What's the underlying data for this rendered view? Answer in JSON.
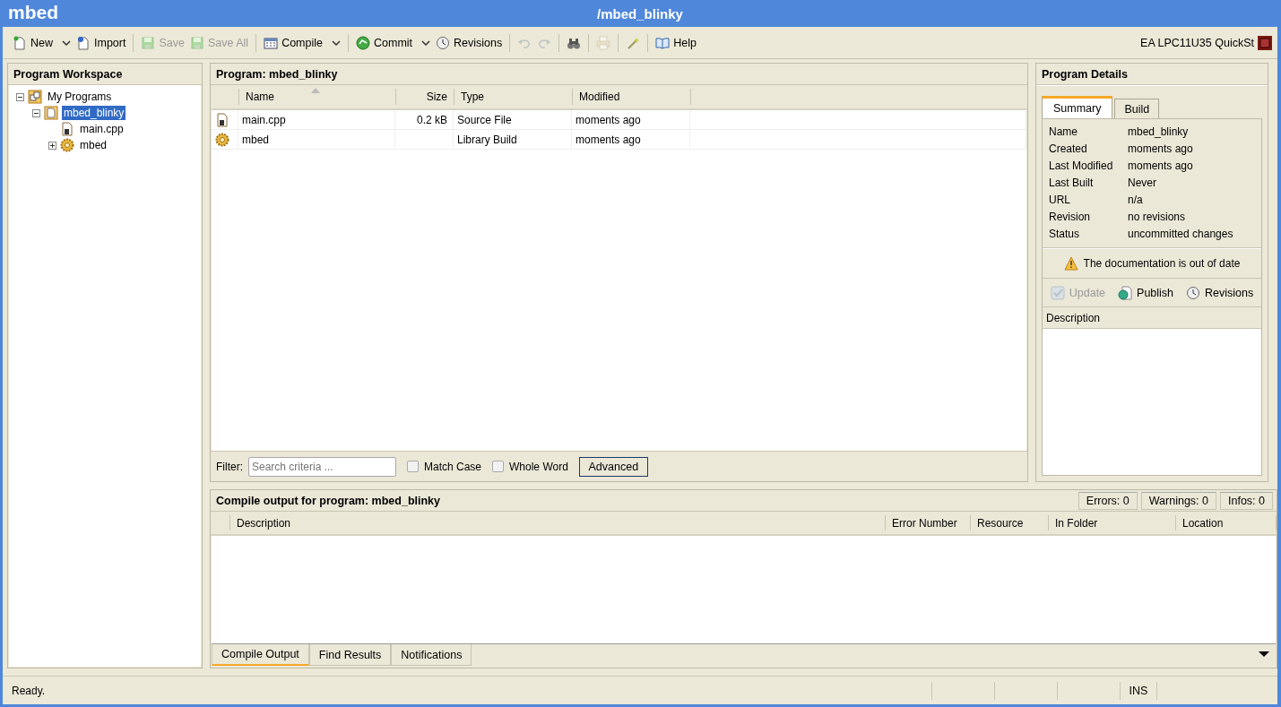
{
  "window": {
    "logo": "mbed",
    "title": "/mbed_blinky"
  },
  "toolbar": {
    "items": [
      {
        "kind": "button",
        "label": "New",
        "dropdown": true,
        "disabled": false
      },
      {
        "kind": "button",
        "label": "Import",
        "dropdown": false,
        "disabled": false
      },
      {
        "kind": "separator"
      },
      {
        "kind": "button",
        "label": "Save",
        "dropdown": false,
        "disabled": true
      },
      {
        "kind": "button",
        "label": "Save All",
        "dropdown": false,
        "disabled": true
      },
      {
        "kind": "separator"
      },
      {
        "kind": "button",
        "label": "Compile",
        "dropdown": true,
        "disabled": false
      },
      {
        "kind": "separator"
      },
      {
        "kind": "button",
        "label": "Commit",
        "dropdown": true,
        "disabled": false
      },
      {
        "kind": "button",
        "label": "Revisions",
        "dropdown": false,
        "disabled": false
      },
      {
        "kind": "separator"
      },
      {
        "kind": "icon",
        "disabled": true
      },
      {
        "kind": "icon",
        "disabled": true
      },
      {
        "kind": "separator"
      },
      {
        "kind": "icon",
        "disabled": false
      },
      {
        "kind": "separator"
      },
      {
        "kind": "icon",
        "disabled": true
      },
      {
        "kind": "separator"
      },
      {
        "kind": "icon",
        "disabled": false
      },
      {
        "kind": "separator"
      },
      {
        "kind": "button",
        "label": "Help",
        "dropdown": false,
        "disabled": false
      }
    ],
    "device": "EA LPC11U35 QuickSt"
  },
  "workspace": {
    "title": "Program Workspace",
    "tree": [
      {
        "kind": "folder",
        "label": "My Programs",
        "expanded": true,
        "selected": false,
        "children": [
          {
            "kind": "program",
            "label": "mbed_blinky",
            "expanded": true,
            "selected": true,
            "children": [
              {
                "kind": "file",
                "label": "main.cpp",
                "selected": false
              },
              {
                "kind": "library",
                "label": "mbed",
                "expanded": false,
                "selected": false
              }
            ]
          }
        ]
      }
    ]
  },
  "program": {
    "title": "Program: mbed_blinky",
    "columns": [
      {
        "label": "Name",
        "sorted": true
      },
      {
        "label": "Size",
        "sorted": false
      },
      {
        "label": "Type",
        "sorted": false
      },
      {
        "label": "Modified",
        "sorted": false
      }
    ],
    "rows": [
      {
        "kind": "file",
        "cells": [
          "main.cpp",
          "0.2 kB",
          "Source File",
          "moments ago"
        ]
      },
      {
        "kind": "library",
        "cells": [
          "mbed",
          "",
          "Library Build",
          "moments ago"
        ]
      }
    ],
    "filter": {
      "label": "Filter:",
      "placeholder": "Search criteria ...",
      "options": [
        {
          "label": "Match Case",
          "checked": false
        },
        {
          "label": "Whole Word",
          "checked": false
        }
      ],
      "button": "Advanced"
    }
  },
  "details": {
    "title": "Program Details",
    "tabs": [
      {
        "label": "Summary",
        "selected": true
      },
      {
        "label": "Build",
        "selected": false
      }
    ],
    "fields": [
      {
        "label": "Name",
        "value": "mbed_blinky"
      },
      {
        "label": "Created",
        "value": "moments ago"
      },
      {
        "label": "Last Modified",
        "value": "moments ago"
      },
      {
        "label": "Last Built",
        "value": "Never"
      },
      {
        "label": "URL",
        "value": "n/a"
      },
      {
        "label": "Revision",
        "value": "no revisions"
      },
      {
        "label": "Status",
        "value": "uncommitted changes"
      }
    ],
    "notice": "The documentation is out of date",
    "actions": [
      {
        "label": "Update",
        "disabled": true
      },
      {
        "label": "Publish",
        "disabled": false
      },
      {
        "label": "Revisions",
        "disabled": false
      }
    ],
    "description_label": "Description"
  },
  "output": {
    "title": "Compile output for program: mbed_blinky",
    "counters": [
      "Errors: 0",
      "Warnings: 0",
      "Infos: 0"
    ],
    "columns": [
      "Description",
      "Error Number",
      "Resource",
      "In Folder",
      "Location"
    ],
    "tabs": [
      {
        "label": "Compile Output",
        "selected": true
      },
      {
        "label": "Find Results",
        "selected": false
      },
      {
        "label": "Notifications",
        "selected": false
      }
    ]
  },
  "status_bar": {
    "message": "Ready.",
    "mode": "INS"
  }
}
